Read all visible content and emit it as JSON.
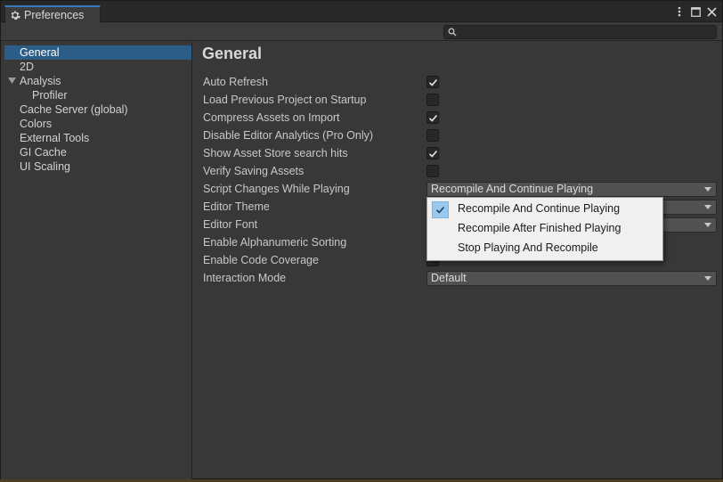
{
  "window": {
    "tab_title": "Preferences",
    "menu_icon": "kebab-menu-icon",
    "maximize_icon": "maximize-icon",
    "close_icon": "close-icon"
  },
  "search": {
    "value": "",
    "placeholder": ""
  },
  "sidebar": {
    "items": [
      {
        "label": "General",
        "selected": true
      },
      {
        "label": "2D"
      },
      {
        "label": "Analysis",
        "foldout": "expanded"
      },
      {
        "label": "Profiler",
        "child": true
      },
      {
        "label": "Cache Server (global)"
      },
      {
        "label": "Colors"
      },
      {
        "label": "External Tools"
      },
      {
        "label": "GI Cache"
      },
      {
        "label": "UI Scaling"
      }
    ]
  },
  "main": {
    "title": "General",
    "rows": [
      {
        "label": "Auto Refresh",
        "type": "checkbox",
        "checked": true
      },
      {
        "label": "Load Previous Project on Startup",
        "type": "checkbox",
        "checked": false
      },
      {
        "label": "Compress Assets on Import",
        "type": "checkbox",
        "checked": true
      },
      {
        "label": "Disable Editor Analytics (Pro Only)",
        "type": "checkbox",
        "checked": false
      },
      {
        "label": "Show Asset Store search hits",
        "type": "checkbox",
        "checked": true
      },
      {
        "label": "Verify Saving Assets",
        "type": "checkbox",
        "checked": false
      },
      {
        "label": "Script Changes While Playing",
        "type": "dropdown",
        "value": "Recompile And Continue Playing"
      },
      {
        "label": "Editor Theme",
        "type": "dropdown",
        "value": ""
      },
      {
        "label": "Editor Font",
        "type": "dropdown",
        "value": ""
      },
      {
        "label": "Enable Alphanumeric Sorting",
        "type": "checkbox",
        "checked": false
      },
      {
        "label": "Enable Code Coverage",
        "type": "checkbox",
        "checked": false
      },
      {
        "label": "Interaction Mode",
        "type": "dropdown",
        "value": "Default"
      }
    ]
  },
  "popup": {
    "options": [
      {
        "label": "Recompile And Continue Playing",
        "selected": true
      },
      {
        "label": "Recompile After Finished Playing"
      },
      {
        "label": "Stop Playing And Recompile"
      }
    ]
  },
  "colors": {
    "selection": "#2c5d87",
    "tab_accent": "#3a79bb",
    "popup_check": "#99c9ef"
  }
}
